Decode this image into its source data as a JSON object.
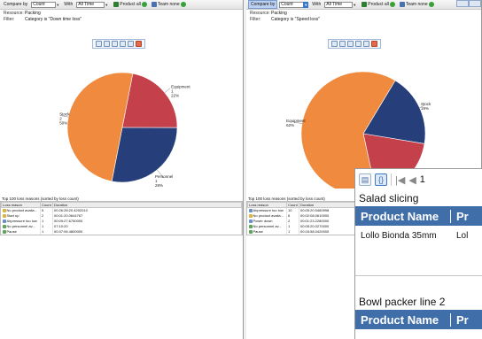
{
  "left": {
    "toolbar": {
      "compare_by_label": "Compare by",
      "compare_by_value": "Count",
      "with_label": "With",
      "with_value": "All Time",
      "product_label": "Product all",
      "team_label": "Team none"
    },
    "info": [
      {
        "key": "Resource:",
        "value": "Packing"
      },
      {
        "key": "Filter:",
        "value": "Category is \"Down time loss\""
      }
    ],
    "pie_slices": [
      {
        "label": "Equipment",
        "value": 22,
        "color": "#c4404a"
      },
      {
        "label": "Personnel",
        "value": 28,
        "color": "#263f7a"
      },
      {
        "label": "Stock",
        "value": 50,
        "color": "#ef8a3e"
      }
    ],
    "pie_labels": [
      {
        "text": "Equipment",
        "sub": "1",
        "pct": "22%"
      },
      {
        "text": "Personnel",
        "sub": "1",
        "pct": "28%"
      },
      {
        "text": "Stock",
        "sub": "2",
        "pct": "50%"
      }
    ],
    "table_title": "Top 100 loss reasons (sorted by loss count)",
    "columns": [
      "Loss reason",
      "Count",
      "Duration"
    ],
    "rows": [
      {
        "reason": "No product availa...",
        "count": "5",
        "duration": "00:26:28:20.4202010",
        "icon": "#e0b33b"
      },
      {
        "reason": "Start up",
        "count": "2",
        "duration": "00:01:20.0644767",
        "icon": "#e0b33b"
      },
      {
        "reason": "Airpressure too low",
        "count": "1",
        "duration": "00:09:27.6750000",
        "icon": "#6b8fc7"
      },
      {
        "reason": "No personnel av...",
        "count": "1",
        "duration": "07:10:20",
        "icon": "#5aa65a"
      },
      {
        "reason": "Pause",
        "count": "1",
        "duration": "00:37:06.4800000",
        "icon": "#5aa65a"
      }
    ]
  },
  "right": {
    "toolbar": {
      "compare_by_label": "Compare by",
      "compare_by_value": "Count",
      "with_label": "With",
      "with_value": "All Time",
      "product_label": "Product all",
      "team_label": "Team none"
    },
    "info": [
      {
        "key": "Resource:",
        "value": "Packing"
      },
      {
        "key": "Filter:",
        "value": "Category is \"Speed loss\""
      }
    ],
    "pie_slices": [
      {
        "label": "Stock",
        "value": 19,
        "color": "#263f7a"
      },
      {
        "label": "Personnel",
        "value": 19,
        "color": "#c4404a"
      },
      {
        "label": "Equipment",
        "value": 62,
        "color": "#ef8a3e"
      }
    ],
    "pie_labels": [
      {
        "text": "Stock",
        "sub": "",
        "pct": "19%"
      },
      {
        "text": "Personnel",
        "sub": "",
        "pct": "19%"
      },
      {
        "text": "Equipment",
        "sub": "",
        "pct": "62%"
      }
    ],
    "table_title": "Top 100 loss reasons (sorted by loss count)",
    "columns": [
      "Loss reason",
      "Count",
      "Duration"
    ],
    "rows": [
      {
        "reason": "Airpressure too low",
        "count": "10",
        "duration": "00:05:20.5460998",
        "icon": "#6b8fc7"
      },
      {
        "reason": "No product availa...",
        "count": "6",
        "duration": "00:02:08.0610000",
        "icon": "#e0b33b"
      },
      {
        "reason": "Power down",
        "count": "2",
        "duration": "00:01:23.2280000",
        "icon": "#6b8fc7"
      },
      {
        "reason": "No personnel av...",
        "count": "1",
        "duration": "00:05:20.0270000",
        "icon": "#5aa65a"
      },
      {
        "reason": "Pause",
        "count": "1",
        "duration": "00:16:58.0420000",
        "icon": "#5aa65a"
      }
    ]
  },
  "report": {
    "page_number": "1",
    "sections": [
      {
        "title": "Salad slicing",
        "header": [
          "Product Name",
          "Pr"
        ],
        "row": [
          "Lollo Bionda 35mm",
          "Lol"
        ]
      },
      {
        "title": "Bowl packer line 2",
        "header": [
          "Product Name",
          "Pr"
        ],
        "row": []
      }
    ]
  }
}
